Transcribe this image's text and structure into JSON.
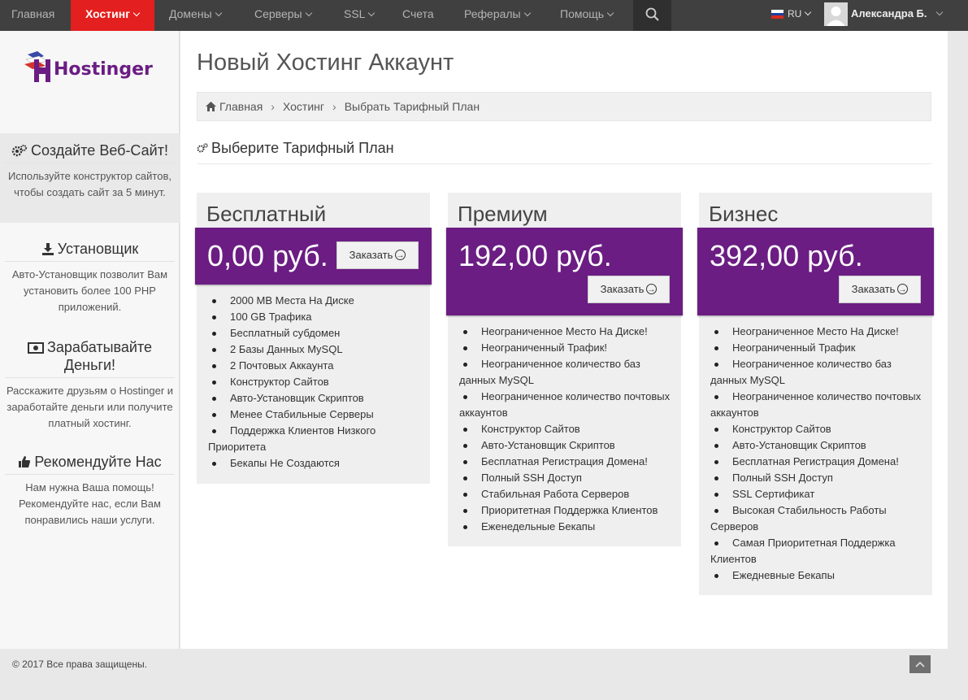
{
  "nav": {
    "items": [
      {
        "label": "Главная"
      },
      {
        "label": "Хостинг"
      },
      {
        "label": "Домены"
      },
      {
        "label": "Серверы"
      },
      {
        "label": "SSL"
      },
      {
        "label": "Счета"
      },
      {
        "label": "Рефералы"
      },
      {
        "label": "Помощь"
      }
    ],
    "active": "Хостинг",
    "language": "RU",
    "user_name": "Александра Б."
  },
  "sidebar": {
    "logo_text": "Hostinger",
    "blocks": [
      {
        "title": "Создайте Веб-Сайт!",
        "text": "Используйте конструктор сайтов, чтобы создать сайт за 5 минут.",
        "icon": "gears-icon"
      },
      {
        "title": "Установщик",
        "text": "Авто-Установщик позволит Вам установить более 100 PHP приложений.",
        "icon": "download-icon"
      },
      {
        "title": "Зарабатывайте Деньги!",
        "text": "Расскажите друзьям о Hostinger и заработайте деньги или получите платный хостинг.",
        "icon": "money-icon"
      },
      {
        "title": "Рекомендуйте Нас",
        "text": "Нам нужна Ваша помощь! Рекомендуйте нас, если Вам понравились наши услуги.",
        "icon": "thumbs-up-icon"
      }
    ]
  },
  "main": {
    "title": "Новый Хостинг Аккаунт",
    "breadcrumb": [
      "Главная",
      "Хостинг",
      "Выбрать Тарифный План"
    ],
    "section_title": "Выберите Тарифный План",
    "order_label": "Заказать",
    "plans": [
      {
        "name": "Бесплатный",
        "price": "0,00 руб.",
        "features": [
          "2000 MB Места На Диске",
          "100 GB Трафика",
          "Бесплатный субдомен",
          "2 Базы Данных MySQL",
          "2 Почтовых Аккаунта",
          "Конструктор Сайтов",
          "Авто-Установщик Скриптов",
          "Менее Стабильные Серверы",
          "Поддержка Клиентов Низкого Приоритета",
          "Бекапы Не Создаются"
        ]
      },
      {
        "name": "Премиум",
        "price": "192,00 руб.",
        "features": [
          "Неограниченное Место На Диске!",
          "Неограниченный Трафик!",
          "Неограниченное количество баз данных MySQL",
          "Неограниченное количество почтовых аккаунтов",
          "Конструктор Сайтов",
          "Авто-Установщик Скриптов",
          "Бесплатная Регистрация Домена!",
          "Полный SSH Доступ",
          "Стабильная Работа Серверов",
          "Приоритетная Поддержка Клиентов",
          "Еженедельные Бекапы"
        ]
      },
      {
        "name": "Бизнес",
        "price": "392,00 руб.",
        "features": [
          "Неограниченное Место На Диске!",
          "Неограниченный Трафик",
          "Неограниченное количество баз данных MySQL",
          "Неограниченное количество почтовых аккаунтов",
          "Конструктор Сайтов",
          "Авто-Установщик Скриптов",
          "Бесплатная Регистрация Домена!",
          "Полный SSH Доступ",
          "SSL Сертификат",
          "Высокая Стабильность Работы Серверов",
          "Самая Приоритетная Поддержка Клиентов",
          "Ежедневные Бекапы"
        ]
      }
    ]
  },
  "footer": {
    "copyright": "© 2017 Все права защищены."
  },
  "colors": {
    "nav_bg": "#404040",
    "nav_active": "#e3201f",
    "plan_accent": "#6b1d83"
  }
}
